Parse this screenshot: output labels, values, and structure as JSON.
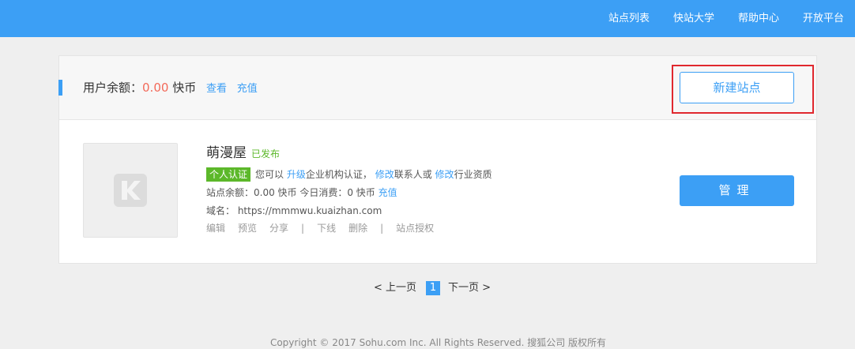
{
  "topnav": [
    "站点列表",
    "快站大学",
    "帮助中心",
    "开放平台"
  ],
  "account": {
    "balance_label": "用户余额：",
    "balance_value": "0.00",
    "currency": " 快币",
    "view_link": "查看",
    "recharge_link": "充值",
    "create_button": "新建站点"
  },
  "site": {
    "name": "萌漫屋",
    "status": "已发布",
    "badge": "个人认证",
    "verify_prefix": "您可以 ",
    "upgrade_link": "升级",
    "verify_mid1": "企业机构认证，",
    "modify_link1": "修改",
    "verify_mid2": "联系人或 ",
    "modify_link2": "修改",
    "verify_suffix": "行业资质",
    "stats_text": "站点余额：0.00 快币   今日消费：0 快币",
    "stats_recharge": "充值",
    "domain_text": "域名： https://mmmwu.kuaizhan.com",
    "actions": [
      "编辑",
      "预览",
      "分享",
      "|",
      "下线",
      "删除",
      "|",
      "站点授权"
    ],
    "manage_button": "管理"
  },
  "pager": {
    "prev": "< 上一页",
    "current": "1",
    "next": "下一页 >"
  },
  "footer": "Copyright © 2017 Sohu.com Inc. All Rights Reserved. 搜狐公司 版权所有",
  "colors": {
    "accent": "#3c9ff5",
    "amount": "#f36a5a",
    "published": "#5cb82a",
    "highlight_border": "#e0282e"
  }
}
